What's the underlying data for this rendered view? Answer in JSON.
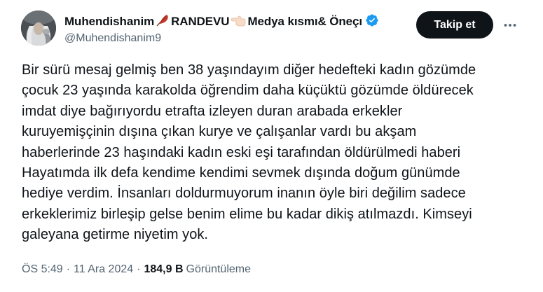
{
  "author": {
    "name_part1": "Muhendishanim",
    "name_part2": "RANDEVU",
    "name_part3": "Medya kısmı& Öneçı",
    "handle": "@Muhendishanim9",
    "emoji1": "feather-icon",
    "emoji2": "pointing-left-hand-icon",
    "verified": "verified-badge-icon"
  },
  "actions": {
    "follow_label": "Takip et",
    "more_icon": "more-icon"
  },
  "tweet": {
    "lines": [
      "Bir sürü mesaj gelmiş ben 38 yaşındayım diğer hedefteki kadın gözümde",
      "çocuk 23 yaşında karakolda öğrendim daha küçüktü gözümde öldürecek",
      "imdat diye bağırıyordu etrafta izleyen duran arabada erkekler",
      "kuruyemişçinin dışına çıkan kurye ve çalışanlar vardı bu akşam",
      "haberlerinde 23 haşındaki kadın eski eşi tarafından öldürülmedi haberi",
      "Hayatımda ilk defa kendime kendimi sevmek dışında doğum günümde",
      "hediye verdim. İnsanları doldurmuyorum inanın öyle biri değilim sadece",
      "erkeklerimiz birleşip gelse benim elime bu kadar dikiş atılmazdı. Kimseyi",
      "galeyana getirme niyetim yok."
    ]
  },
  "meta": {
    "time": "ÖS 5:49",
    "separator": "·",
    "date": "11 Ara 2024",
    "views_count": "184,9 B",
    "views_label": "Görüntüleme"
  },
  "colors": {
    "text": "#0f1419",
    "secondary": "#536471",
    "verified": "#1d9bf0",
    "button": "#0f1419"
  }
}
